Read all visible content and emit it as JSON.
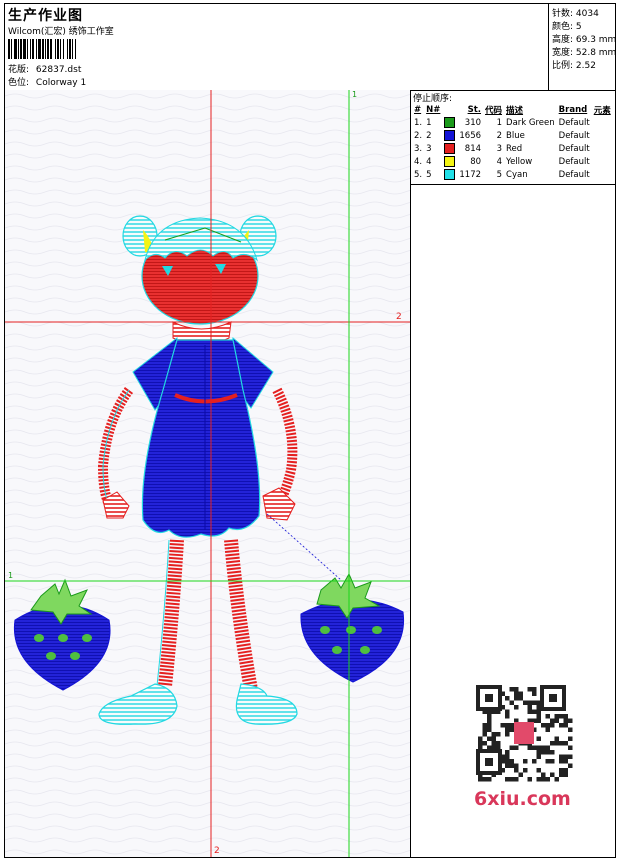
{
  "header": {
    "title": "生产作业图",
    "company": "Wilcom(汇宏) 绣饰工作室",
    "design_file_label": "花版:",
    "design_file": "62837.dst",
    "colorway_label": "色位:",
    "colorway": "Colorway 1"
  },
  "stats": {
    "stitches": "针数: 4034",
    "colors": "颜色: 5",
    "height": "高度: 69.3 mm",
    "width": "宽度: 52.8 mm",
    "scale": "比例: 2.52"
  },
  "stop_sequence": {
    "title": "停止顺序:",
    "headers": [
      "#",
      "N#",
      "",
      "St.",
      "代码",
      "描述",
      "Brand",
      "元素"
    ],
    "rows": [
      {
        "num": "1.",
        "n": "1",
        "color": "#1a9a1a",
        "st": "310",
        "code": "1",
        "desc": "Dark Green",
        "brand": "Default"
      },
      {
        "num": "2.",
        "n": "2",
        "color": "#1313d6",
        "st": "1656",
        "code": "2",
        "desc": "Blue",
        "brand": "Default"
      },
      {
        "num": "3.",
        "n": "3",
        "color": "#e52020",
        "st": "814",
        "code": "3",
        "desc": "Red",
        "brand": "Default"
      },
      {
        "num": "4.",
        "n": "4",
        "color": "#f4f414",
        "st": "80",
        "code": "4",
        "desc": "Yellow",
        "brand": "Default"
      },
      {
        "num": "5.",
        "n": "5",
        "color": "#22e0e8",
        "st": "1172",
        "code": "5",
        "desc": "Cyan",
        "brand": "Default"
      }
    ]
  },
  "guides": {
    "v1_label": "1",
    "h2_label": "2",
    "h1_label": "1",
    "v2_label": "2"
  },
  "watermark": "6xiu.com"
}
